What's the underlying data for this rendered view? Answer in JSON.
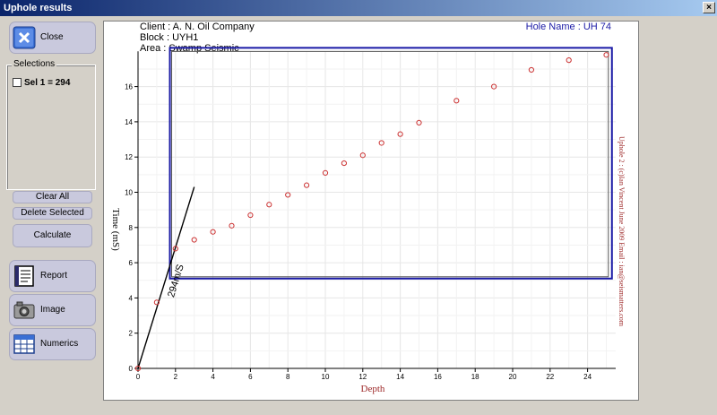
{
  "window": {
    "title": "Uphole results",
    "close_glyph": "×"
  },
  "sidebar": {
    "close_label": "Close",
    "selections_legend": "Selections",
    "selection_items": [
      {
        "label": "Sel 1 = 294",
        "checked": false
      }
    ],
    "clear_all_label": "Clear All",
    "delete_selected_label": "Delete Selected",
    "calculate_label": "Calculate",
    "report_label": "Report",
    "image_label": "Image",
    "numerics_label": "Numerics"
  },
  "header": {
    "client": "Client  :  A. N. Oil Company",
    "block": "Block  :  UYH1",
    "area": "Area    :  Swamp Seismic",
    "hole_name": "Hole Name : UH 74"
  },
  "side_text": "Uphole 2 : (c)Ian Vincent June 2009 Email : ian@seismatters.com",
  "colors": {
    "points": "#cc3333",
    "selection_box": "#1a1aa6",
    "axis_label": "#9e2a2a"
  },
  "chart_data": {
    "type": "scatter",
    "xlabel": "Depth",
    "ylabel": "Time (mS)",
    "xlim": [
      0,
      25.5
    ],
    "ylim": [
      0,
      18
    ],
    "xticks": [
      0,
      2,
      4,
      6,
      8,
      10,
      12,
      14,
      16,
      18,
      20,
      22,
      24
    ],
    "yticks": [
      0,
      2,
      4,
      6,
      8,
      10,
      12,
      14,
      16
    ],
    "points": [
      [
        0,
        0
      ],
      [
        1,
        3.75
      ],
      [
        2,
        6.8
      ],
      [
        3,
        7.3
      ],
      [
        4,
        7.75
      ],
      [
        5,
        8.1
      ],
      [
        6,
        8.7
      ],
      [
        7,
        9.3
      ],
      [
        8,
        9.85
      ],
      [
        9,
        10.4
      ],
      [
        10,
        11.1
      ],
      [
        11,
        11.65
      ],
      [
        12,
        12.1
      ],
      [
        13,
        12.8
      ],
      [
        14,
        13.3
      ],
      [
        15,
        13.95
      ],
      [
        17,
        15.2
      ],
      [
        19,
        16.0
      ],
      [
        21,
        16.95
      ],
      [
        23,
        17.5
      ],
      [
        25,
        17.8
      ]
    ],
    "velocity_line": {
      "label": "294m/S",
      "from": [
        0,
        0
      ],
      "to": [
        3,
        10.3
      ]
    },
    "selection_box": {
      "x0": 1.7,
      "x1": 25.3,
      "y0": 5.1,
      "y1": 18.2
    }
  }
}
